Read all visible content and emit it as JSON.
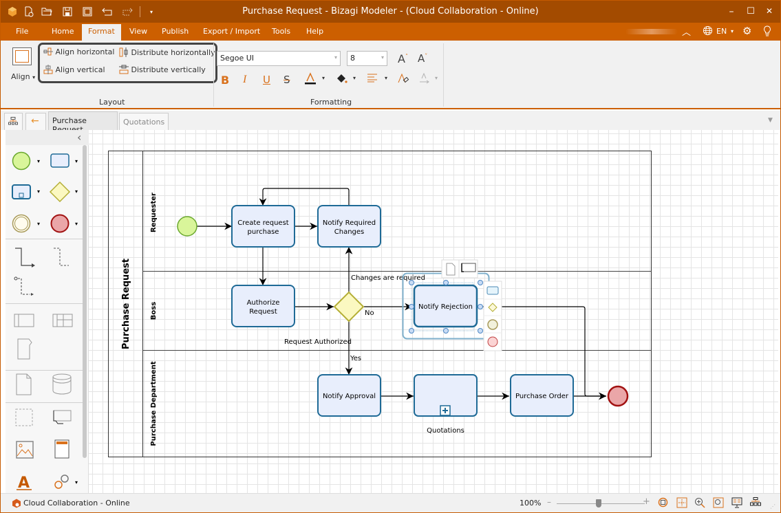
{
  "window": {
    "title": "Purchase Request - Bizagi Modeler - (Cloud Collaboration - Online)",
    "minimize": "–",
    "maximize": "☐",
    "close": "✕"
  },
  "quick_access": [
    "app-logo",
    "new-file",
    "open-file",
    "save",
    "save-as",
    "undo",
    "redo",
    "customize"
  ],
  "menu": {
    "items": [
      "File",
      "Home",
      "Format",
      "View",
      "Publish",
      "Export / Import",
      "Tools",
      "Help"
    ],
    "active": "Format",
    "language": "EN"
  },
  "ribbon": {
    "align_label": "Align",
    "layout_buttons": [
      "Align horizontal",
      "Distribute horizontally",
      "Align vertical",
      "Distribute vertically"
    ],
    "layout_group": "Layout",
    "font_family": "Segoe UI",
    "font_size": "8",
    "formatting_group": "Formatting",
    "format_buttons": {
      "bold": "B",
      "italic": "I",
      "underline": "U",
      "strike": "S"
    }
  },
  "tabs": {
    "items": [
      "Purchase Request",
      "Quotations"
    ],
    "active": "Purchase Request"
  },
  "diagram": {
    "pool": "Purchase Request",
    "lanes": [
      "Requester",
      "Boss",
      "Purchase Department"
    ],
    "tasks": {
      "create": "Create request purchase",
      "create_l1": "Create request",
      "create_l2": "purchase",
      "notify_changes_l1": "Notify Required",
      "notify_changes_l2": "Changes",
      "authorize_l1": "Authorize",
      "authorize_l2": "Request",
      "notify_rejection": "Notify Rejection",
      "notify_approval": "Notify Approval",
      "quotations": "Quotations",
      "purchase_order": "Purchase Order"
    },
    "labels": {
      "changes_required": "Changes are required",
      "no": "No",
      "request_authorized": "Request Authorized",
      "yes": "Yes"
    },
    "colors": {
      "task_fill": "#e8eefc",
      "task_stroke": "#1e6a96",
      "start_fill": "#d9f59a",
      "start_stroke": "#6aa82e",
      "end_fill": "#eaa6a8",
      "end_stroke": "#a11111",
      "gateway_fill": "#fbf8c1",
      "gateway_stroke": "#b4ae35"
    }
  },
  "status": {
    "connection": "Cloud Collaboration - Online",
    "zoom": "100%",
    "zoom_level_percent": 100,
    "zoom_minus": "–",
    "zoom_plus": "+"
  }
}
